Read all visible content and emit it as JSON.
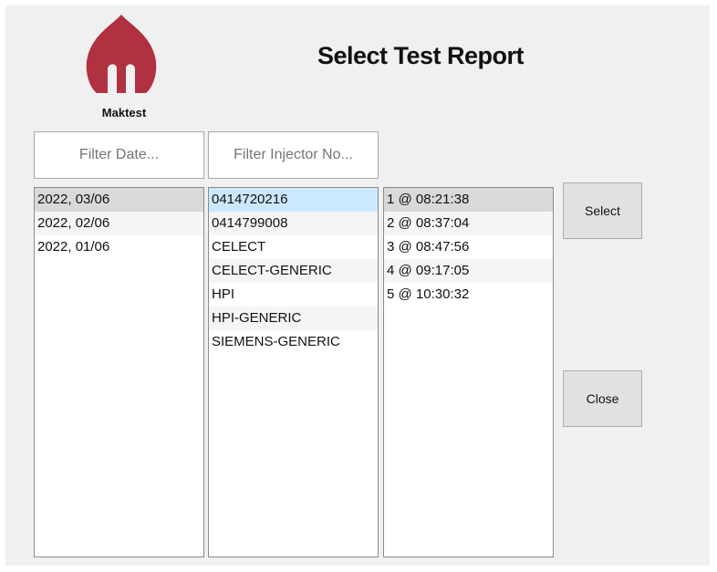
{
  "header": {
    "logo_text": "Maktest",
    "title": "Select Test Report"
  },
  "filters": {
    "date_placeholder": "Filter Date...",
    "injector_placeholder": "Filter Injector No..."
  },
  "dates": [
    "2022, 03/06",
    "2022, 02/06",
    "2022, 01/06"
  ],
  "injectors": [
    "0414720216",
    "0414799008",
    "CELECT",
    "CELECT-GENERIC",
    "HPI",
    "HPI-GENERIC",
    "SIEMENS-GENERIC"
  ],
  "tests": [
    "1 @ 08:21:38",
    "2 @ 08:37:04",
    "3 @ 08:47:56",
    "4 @ 09:17:05",
    "5 @ 10:30:32"
  ],
  "buttons": {
    "select_label": "Select",
    "close_label": "Close"
  },
  "colors": {
    "brand": "#b0313f",
    "selection_gray": "#d9d9d9",
    "selection_blue": "#cce8ff"
  }
}
